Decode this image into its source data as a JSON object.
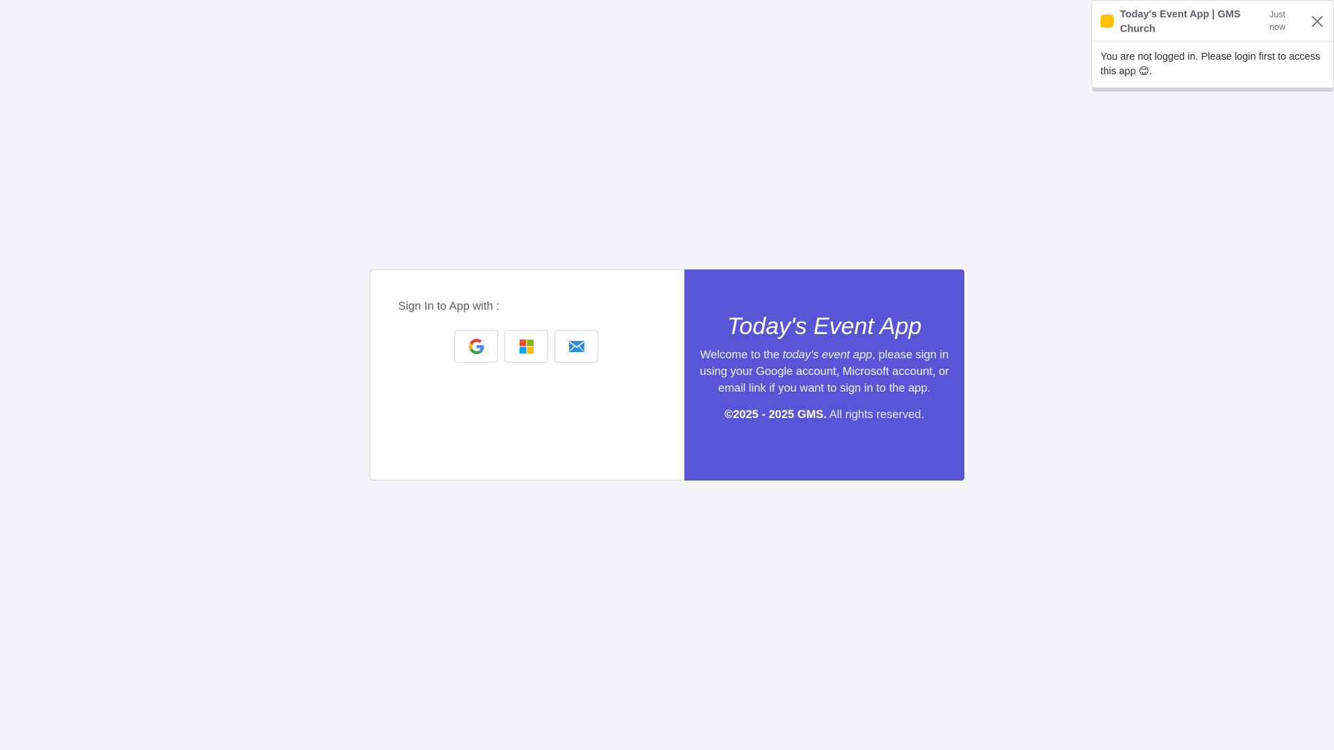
{
  "toast": {
    "title": "Today's Event App | GMS Church",
    "time": "Just now",
    "message": "You are not logged in. Please login first to access this app",
    "emoji": "😊",
    "message_end": ".",
    "status_color": "#ffc107",
    "close_icon": "close-icon"
  },
  "signin": {
    "label": "Sign In to App with :",
    "providers": [
      {
        "name": "Google",
        "icon": "google-icon"
      },
      {
        "name": "Microsoft",
        "icon": "microsoft-icon"
      },
      {
        "name": "Email",
        "icon": "email-icon"
      }
    ]
  },
  "promo": {
    "title": "Today's Event App",
    "welcome_prefix": "Welcome to the ",
    "welcome_em": "today's event app",
    "welcome_suffix": ", please sign in using your Google account, Microsoft account, or email link if you want to sign in to the app.",
    "copyright_bold": "©2025 - 2025 GMS.",
    "copyright_rest": " All rights reserved.",
    "background_color": "#5856d6"
  }
}
